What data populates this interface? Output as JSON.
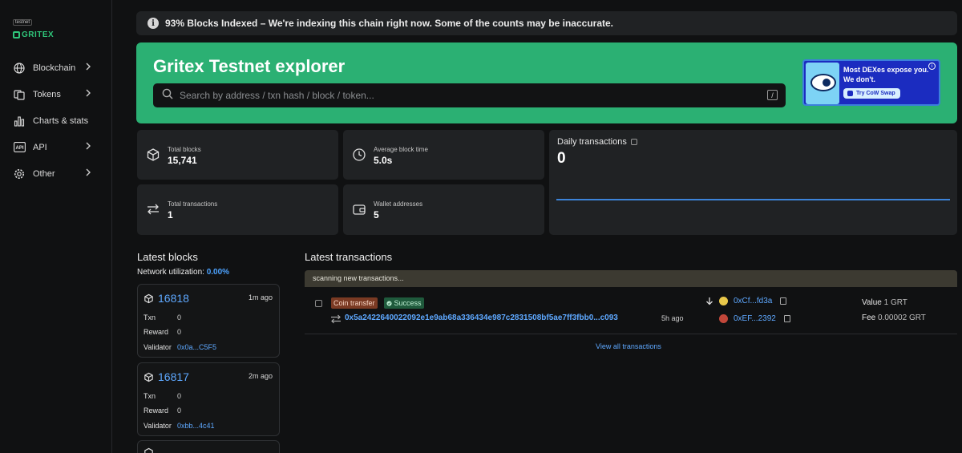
{
  "brand": {
    "badge": "testnet",
    "name": "GRITEX"
  },
  "nav": [
    {
      "label": "Blockchain",
      "icon": "globe-icon"
    },
    {
      "label": "Tokens",
      "icon": "tokens-icon"
    },
    {
      "label": "Charts & stats",
      "icon": "bar-chart-icon"
    },
    {
      "label": "API",
      "icon": "api-icon"
    },
    {
      "label": "Other",
      "icon": "gear-icon"
    }
  ],
  "notice": {
    "text": "93% Blocks Indexed – We're indexing this chain right now. Some of the counts may be inaccurate."
  },
  "hero": {
    "title": "Gritex Testnet explorer",
    "search_placeholder": "Search by address / txn hash / block / token...",
    "shortcut": "/"
  },
  "ad": {
    "line1": "Most DEXes expose you.",
    "line2": "We don't.",
    "cta": "Try CoW Swap",
    "info": "i"
  },
  "stats": {
    "total_blocks": {
      "label": "Total blocks",
      "value": "15,741"
    },
    "avg_block_time": {
      "label": "Average block time",
      "value": "5.0s"
    },
    "total_transactions": {
      "label": "Total transactions",
      "value": "1"
    },
    "wallet_addresses": {
      "label": "Wallet addresses",
      "value": "5"
    }
  },
  "daily": {
    "title": "Daily transactions",
    "value": "0",
    "line_color": "#3c83d8"
  },
  "latest_blocks": {
    "title": "Latest blocks",
    "utilization_label": "Network utilization:",
    "utilization_value": "0.00%",
    "row_labels": {
      "txn": "Txn",
      "reward": "Reward",
      "validator": "Validator"
    },
    "blocks": [
      {
        "number": "16818",
        "ago": "1m ago",
        "txn": "0",
        "reward": "0",
        "validator": "0x0a...C5F5"
      },
      {
        "number": "16817",
        "ago": "2m ago",
        "txn": "0",
        "reward": "0",
        "validator": "0xbb...4c41"
      }
    ]
  },
  "latest_transactions": {
    "title": "Latest transactions",
    "scanning": "scanning new transactions...",
    "tx": {
      "type": "Coin transfer",
      "status": "Success",
      "hash": "0x5a2422640022092e1e9ab68a336434e987c2831508bf5ae7ff3fbb0...c093",
      "ago": "5h ago",
      "from": "0xCf...fd3a",
      "to": "0xEF...2392",
      "value_label": "Value",
      "value": "1 GRT",
      "fee_label": "Fee",
      "fee": "0.00002 GRT"
    },
    "view_all": "View all transactions"
  },
  "colors": {
    "accent_green": "#2bb073",
    "link_blue": "#5ea8ff",
    "background": "#101112",
    "card": "#202224"
  }
}
